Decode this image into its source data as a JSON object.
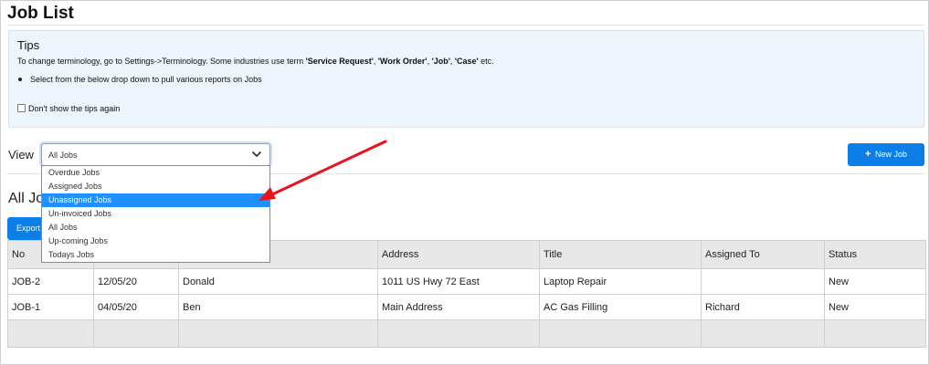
{
  "page": {
    "title": "Job List"
  },
  "tips": {
    "heading": "Tips",
    "line1_prefix": "To change terminology, go to Settings->Terminology. Some industries use term ",
    "terms": [
      "'Service Request'",
      "'Work Order'",
      "'Job'",
      "'Case'"
    ],
    "term_sep": ", ",
    "line1_suffix": " etc.",
    "bullet": "Select from the below drop down to pull various reports on Jobs",
    "checkbox_label": "Don't show the tips again",
    "checkbox_checked": false
  },
  "view": {
    "label": "View",
    "selected": "All Jobs",
    "options": [
      "Overdue Jobs",
      "Assigned Jobs",
      "Unassigned Jobs",
      "Un-invoiced Jobs",
      "All Jobs",
      "Up-coming Jobs",
      "Todays Jobs"
    ],
    "highlighted": "Unassigned Jobs"
  },
  "toolbar": {
    "new_job_label": "New Job",
    "new_job_icon": "plus-icon",
    "export_label": "Export"
  },
  "section": {
    "title": "All Jobs"
  },
  "table": {
    "columns": [
      "No",
      "",
      "",
      "Address",
      "Title",
      "Assigned To",
      "Status"
    ],
    "rows": [
      [
        "JOB-2",
        "12/05/20",
        "Donald",
        "1011 US Hwy 72 East",
        "Laptop Repair",
        "",
        "New"
      ],
      [
        "JOB-1",
        "04/05/20",
        "Ben",
        "Main Address",
        "AC Gas Filling",
        "Richard",
        "New"
      ]
    ]
  },
  "colors": {
    "accent": "#0b7ee8",
    "highlight": "#1e90ff",
    "arrow": "#e8141b",
    "tips_bg": "#eef5fc"
  }
}
